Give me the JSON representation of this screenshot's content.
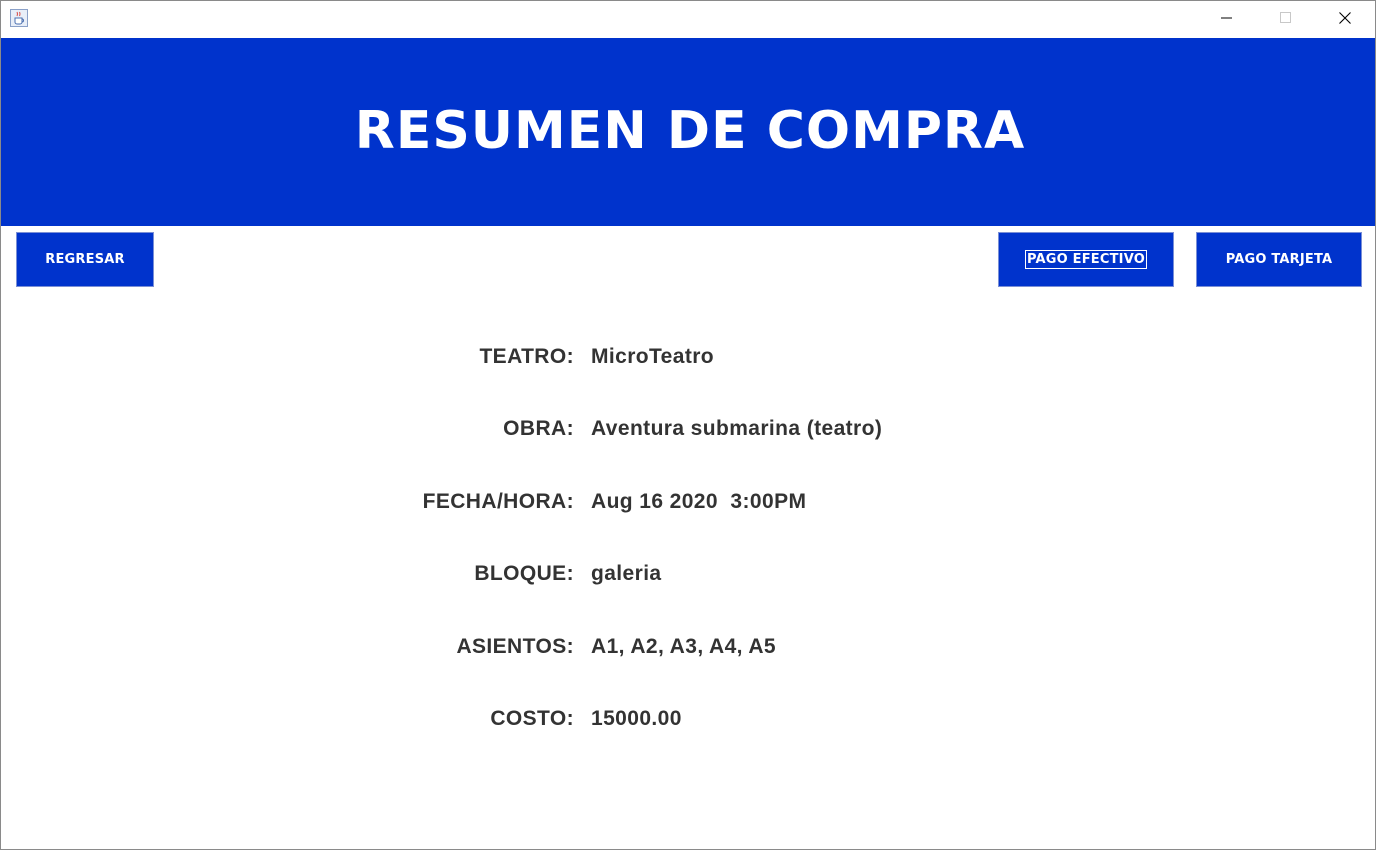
{
  "window": {
    "icon": "java-cup-icon",
    "controls": {
      "minimize": "minimize-icon",
      "maximize": "maximize-icon",
      "close": "close-icon"
    }
  },
  "header": {
    "title": "RESUMEN DE COMPRA"
  },
  "toolbar": {
    "back_label": "REGRESAR",
    "cash_label": "PAGO EFECTIVO",
    "card_label": "PAGO TARJETA"
  },
  "summary": [
    {
      "label": "TEATRO:",
      "value": "MicroTeatro"
    },
    {
      "label": "OBRA:",
      "value": "Aventura submarina (teatro)"
    },
    {
      "label": "FECHA/HORA:",
      "value": "Aug 16 2020  3:00PM"
    },
    {
      "label": "BLOQUE:",
      "value": "galeria"
    },
    {
      "label": "ASIENTOS:",
      "value": "A1, A2, A3, A4, A5"
    },
    {
      "label": "COSTO:",
      "value": "15000.00"
    }
  ],
  "colors": {
    "primary": "#0033cc",
    "text": "#333333",
    "background": "#ffffff"
  }
}
